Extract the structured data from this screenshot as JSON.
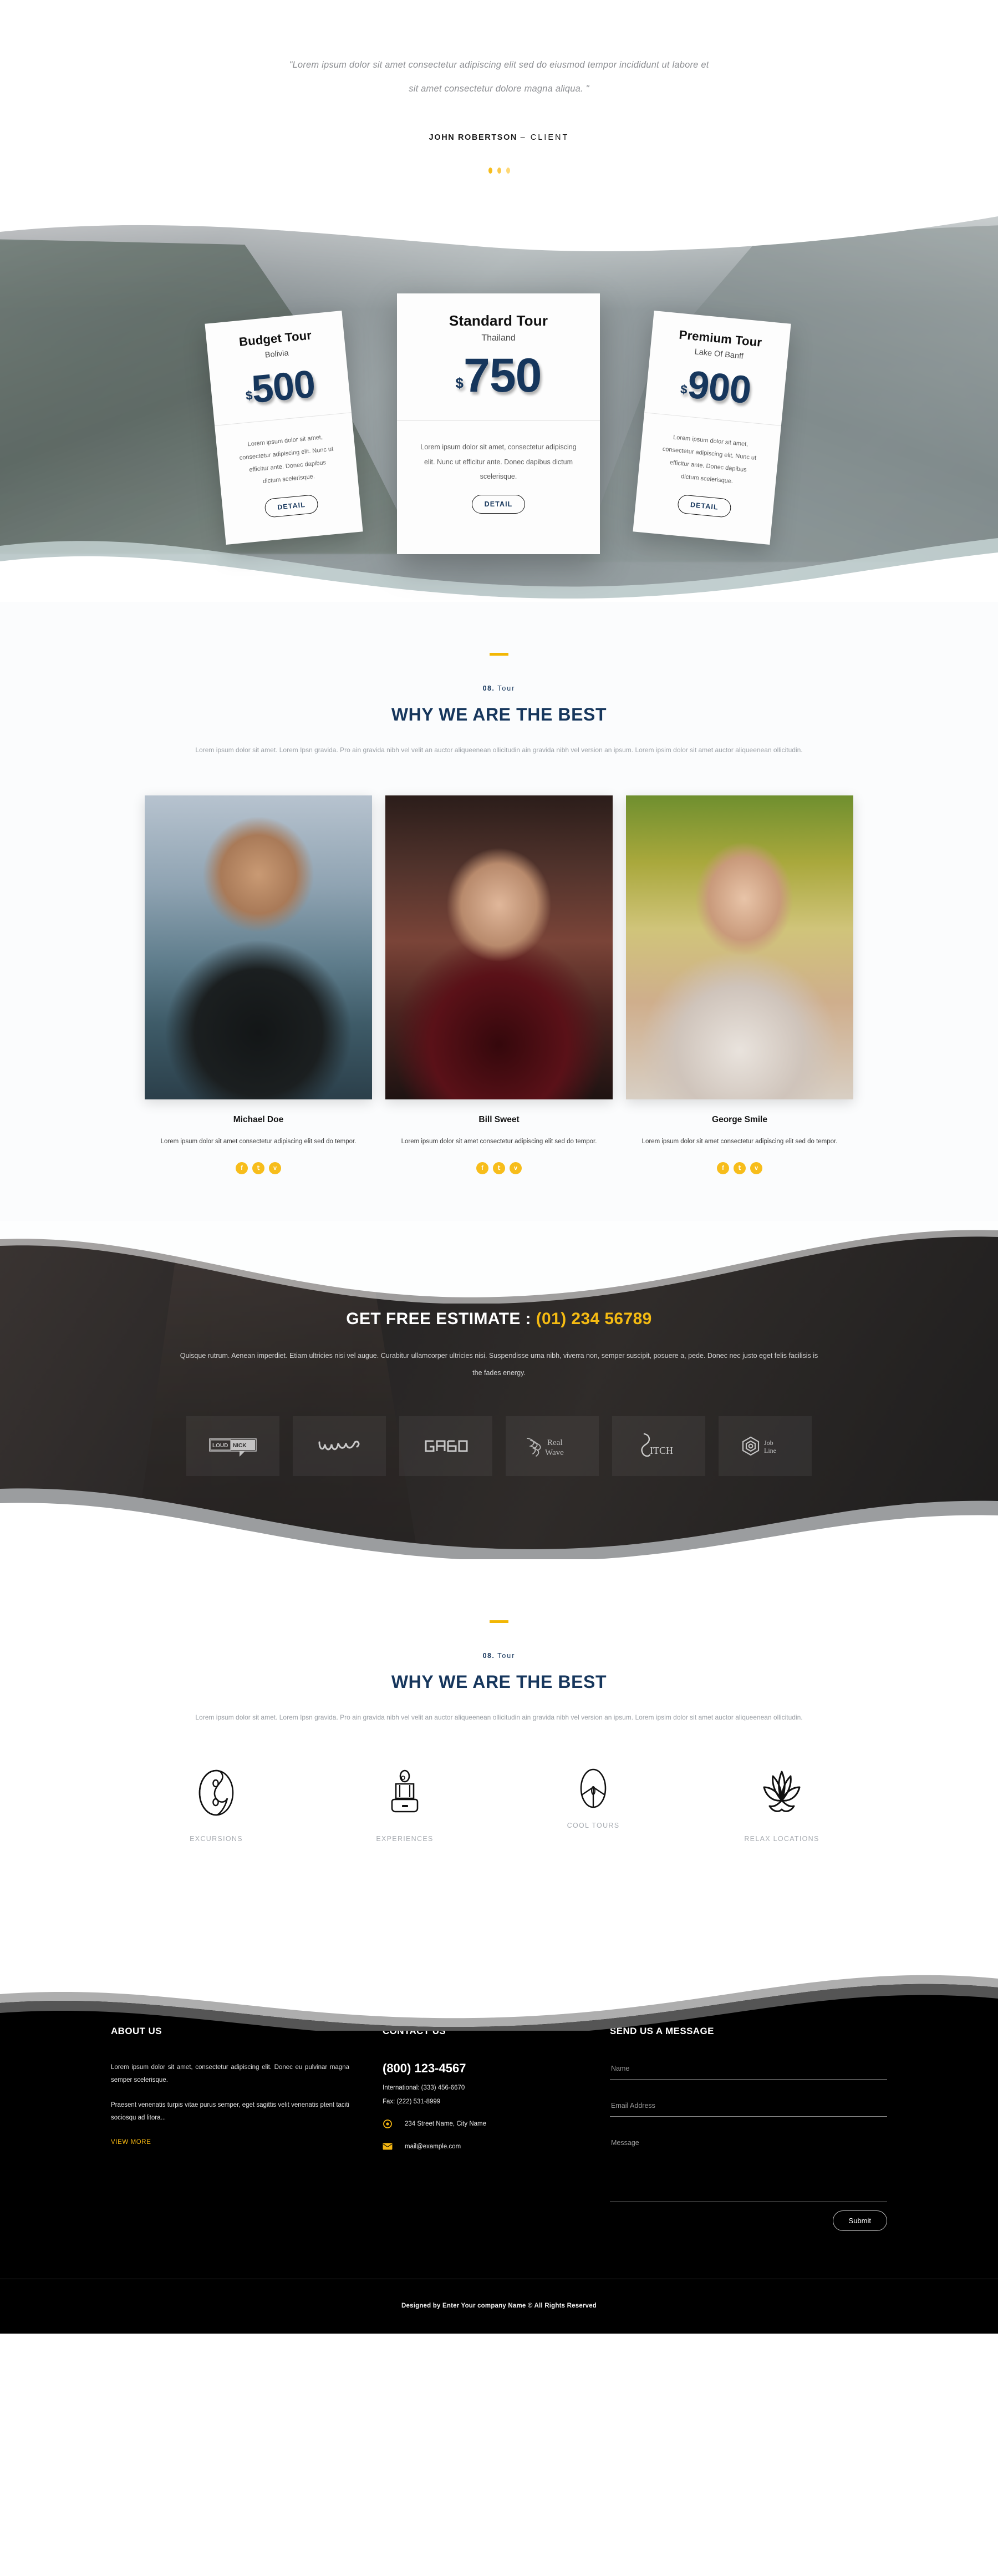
{
  "testimonial": {
    "quote_line1": "\"Lorem ipsum dolor sit amet consectetur adipiscing elit sed do eiusmod tempor incididunt ut labore et",
    "quote_line2": "sit amet consectetur dolore magna aliqua. \"",
    "author_name": "JOHN ROBERTSON",
    "author_role": "– CLIENT",
    "dots_count": 3
  },
  "pricing": {
    "cards": [
      {
        "id": "budget",
        "title": "Budget Tour",
        "subtitle": "Bolivia",
        "currency": "$",
        "amount": "500",
        "description": "Lorem ipsum dolor sit amet, consectetur adipiscing elit. Nunc ut efficitur ante. Donec dapibus dictum scelerisque.",
        "button": "DETAIL"
      },
      {
        "id": "standard",
        "title": "Standard Tour",
        "subtitle": "Thailand",
        "currency": "$",
        "amount": "750",
        "description": "Lorem ipsum dolor sit amet, consectetur adipiscing elit. Nunc ut efficitur ante. Donec dapibus dictum scelerisque.",
        "button": "DETAIL"
      },
      {
        "id": "premium",
        "title": "Premium Tour",
        "subtitle": "Lake Of Banff",
        "currency": "$",
        "amount": "900",
        "description": "Lorem ipsum dolor sit amet, consectetur adipiscing elit. Nunc ut efficitur ante. Donec dapibus dictum scelerisque.",
        "button": "DETAIL"
      }
    ]
  },
  "team_section": {
    "eyebrow_num": "08.",
    "eyebrow_word": "Tour",
    "title": "WHY WE ARE THE BEST",
    "description": "Lorem ipsum dolor sit amet. Lorem Ipsn gravida. Pro ain gravida nibh vel velit an auctor aliqueenean ollicitudin ain gravida nibh vel version an ipsum. Lorem ipsim dolor sit amet auctor aliqueenean ollicitudin.",
    "members": [
      {
        "name": "Michael Doe",
        "bio": "Lorem ipsum dolor sit amet consectetur adipiscing elit sed do tempor.",
        "socials": [
          "facebook-icon",
          "twitter-icon",
          "vimeo-icon"
        ]
      },
      {
        "name": "Bill Sweet",
        "bio": "Lorem ipsum dolor sit amet consectetur adipiscing elit sed do tempor.",
        "socials": [
          "facebook-icon",
          "twitter-icon",
          "vimeo-icon"
        ]
      },
      {
        "name": "George Smile",
        "bio": "Lorem ipsum dolor sit amet consectetur adipiscing elit sed do tempor.",
        "socials": [
          "facebook-icon",
          "twitter-icon",
          "vimeo-icon"
        ]
      }
    ]
  },
  "estimate": {
    "title_prefix": "GET FREE ESTIMATE : ",
    "phone": "(01) 234 56789",
    "description": "Quisque rutrum. Aenean imperdiet. Etiam ultricies nisi vel augue. Curabitur ullamcorper ultricies nisi. Suspendisse urna nibh, viverra non, semper suscipit, posuere a, pede. Donec nec justo eget felis facilisis is the fades energy.",
    "logos": [
      "LOUDNICK",
      "wire",
      "GABO",
      "Real Wave",
      "PITCH",
      "Job Line"
    ]
  },
  "services_section": {
    "eyebrow_num": "08.",
    "eyebrow_word": "Tour",
    "title": "WHY WE ARE THE BEST",
    "description": "Lorem ipsum dolor sit amet. Lorem Ipsn gravida. Pro ain gravida nibh vel velit an auctor aliqueenean ollicitudin ain gravida nibh vel version an ipsum. Lorem ipsim dolor sit amet auctor aliqueenean ollicitudin.",
    "items": [
      {
        "label": "EXCURSIONS",
        "icon": "yin-yang-icon"
      },
      {
        "label": "EXPERIENCES",
        "icon": "meditation-icon"
      },
      {
        "label": "COOL TOURS",
        "icon": "tree-icon"
      },
      {
        "label": "RELAX LOCATIONS",
        "icon": "lotus-icon"
      }
    ]
  },
  "footer": {
    "about": {
      "title": "ABOUT US",
      "paragraph1": "Lorem ipsum dolor sit amet, consectetur adipiscing elit. Donec eu pulvinar magna semper scelerisque.",
      "paragraph2": "Praesent venenatis turpis vitae purus semper, eget sagittis velit venenatis ptent taciti sociosqu ad litora...",
      "view_more": "VIEW MORE"
    },
    "contact": {
      "title": "CONTACT US",
      "phone_main": "(800) 123-4567",
      "phone_international": "International: (333) 456-6670",
      "fax": "Fax: (222) 531-8999",
      "address": "234 Street Name, City Name",
      "email": "mail@example.com"
    },
    "message": {
      "title": "SEND US A MESSAGE",
      "name_placeholder": "Name",
      "email_placeholder": "Email Address",
      "message_placeholder": "Message",
      "submit_label": "Submit"
    },
    "copyright": "Designed by Enter Your company Name © All Rights Reserved"
  },
  "colors": {
    "accent_yellow": "#f2b705",
    "navy": "#16365c",
    "dark": "#262628",
    "footer_bg": "#000000"
  }
}
